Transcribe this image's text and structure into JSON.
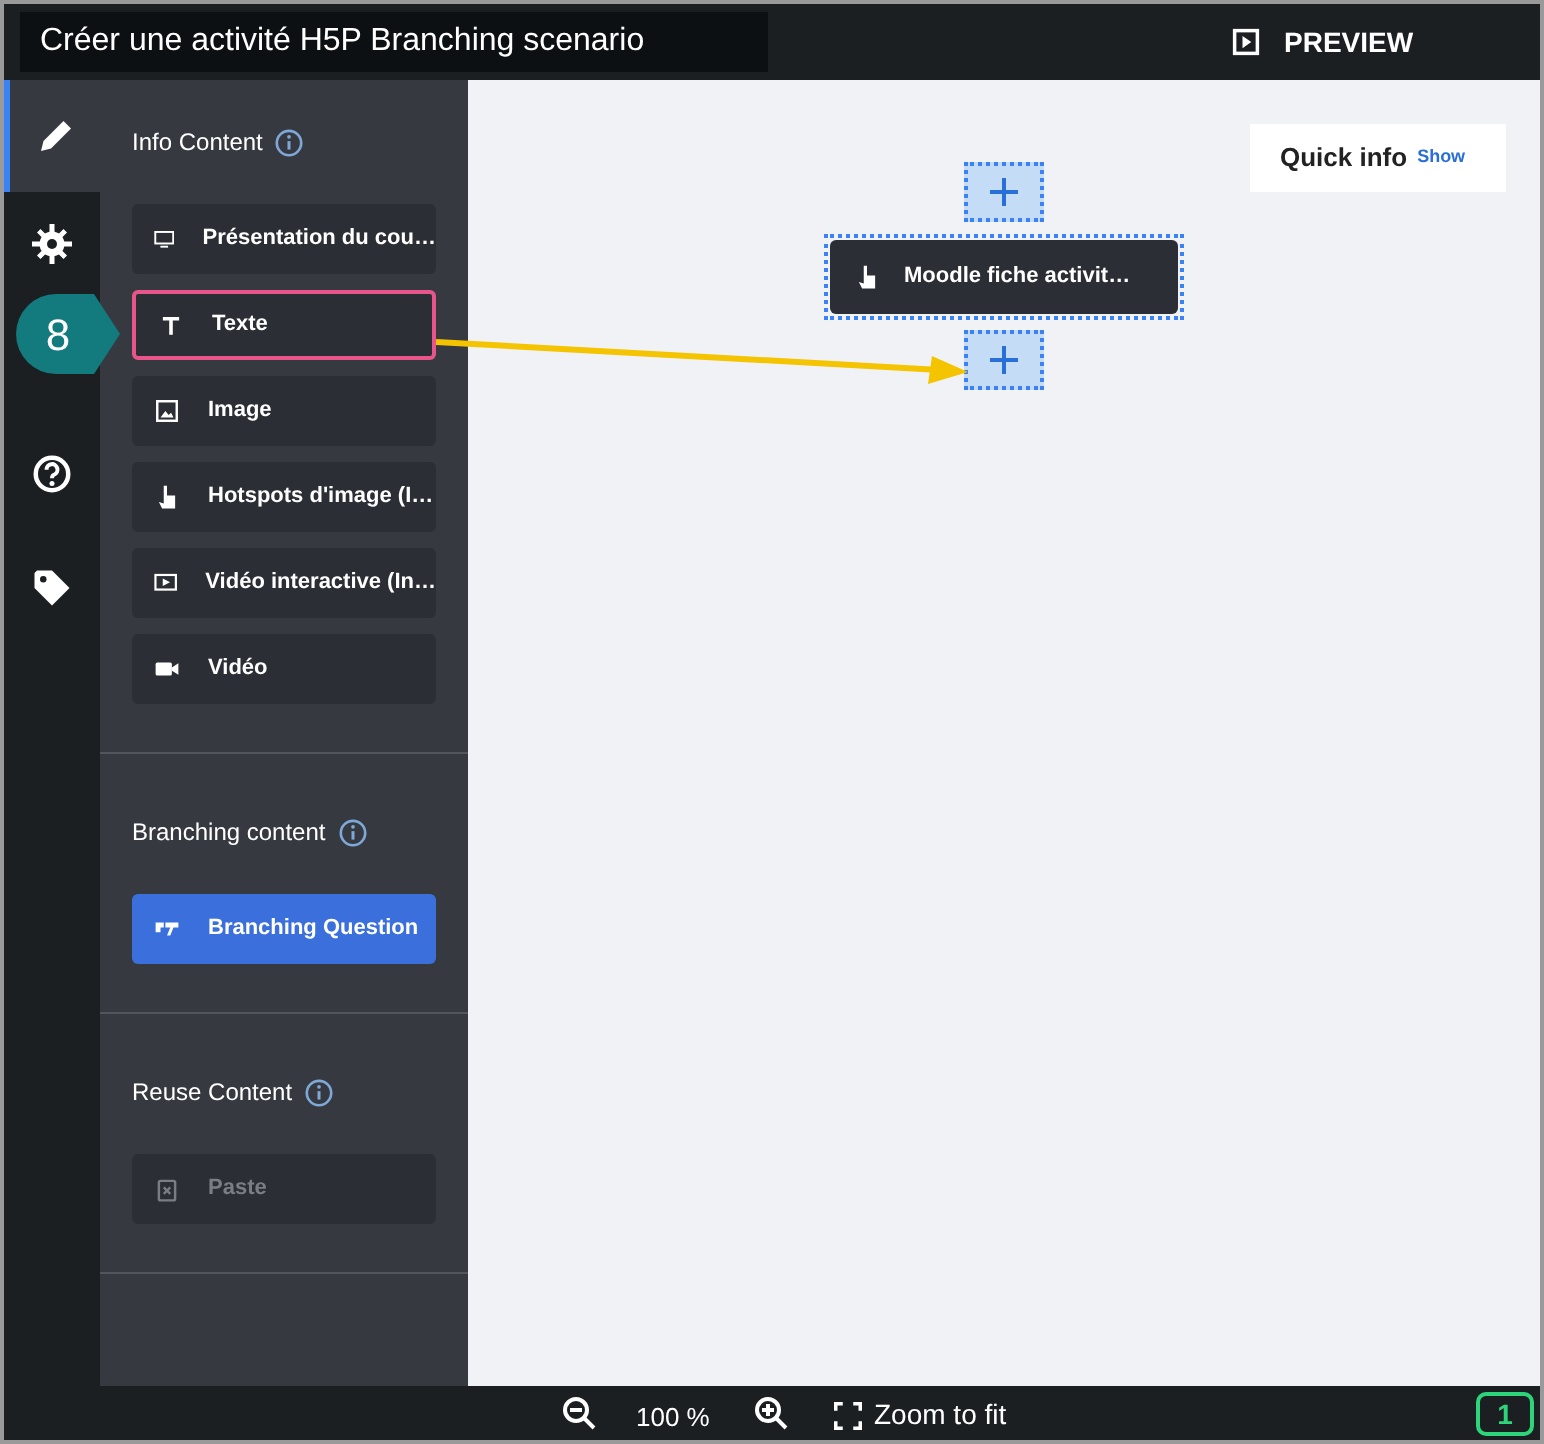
{
  "window": {
    "title": "Créer une activité H5P Branching scenario"
  },
  "preview_button": {
    "label": "PREVIEW"
  },
  "rail_tabs": [
    {
      "kind": "edit",
      "selected": true
    },
    {
      "kind": "settings",
      "selected": false
    },
    {
      "kind": "help",
      "selected": false
    },
    {
      "kind": "tags",
      "selected": false
    }
  ],
  "sections": [
    {
      "title": "Info Content",
      "items": [
        {
          "kind": "presentation",
          "label": "Présentation du cou…",
          "highlighted": false,
          "disabled": false,
          "primary": false
        },
        {
          "kind": "text",
          "label": "Texte",
          "highlighted": true,
          "disabled": false,
          "primary": false
        },
        {
          "kind": "image",
          "label": "Image",
          "highlighted": false,
          "disabled": false,
          "primary": false
        },
        {
          "kind": "hotspot",
          "label": "Hotspots d'image (I…",
          "highlighted": false,
          "disabled": false,
          "primary": false
        },
        {
          "kind": "interactive-video",
          "label": "Vidéo interactive (In…",
          "highlighted": false,
          "disabled": false,
          "primary": false
        },
        {
          "kind": "video",
          "label": "Vidéo",
          "highlighted": false,
          "disabled": false,
          "primary": false
        }
      ]
    },
    {
      "title": "Branching content",
      "items": [
        {
          "kind": "branching",
          "label": "Branching Question",
          "highlighted": false,
          "disabled": false,
          "primary": true
        }
      ]
    },
    {
      "title": "Reuse Content",
      "items": [
        {
          "kind": "paste",
          "label": "Paste",
          "highlighted": false,
          "disabled": true,
          "primary": false
        }
      ]
    }
  ],
  "canvas": {
    "node": {
      "label": "Moodle fiche activit…"
    },
    "quick_info": {
      "label": "Quick info",
      "link": "Show"
    }
  },
  "callout": {
    "label": "8"
  },
  "zoom_bar": {
    "zoom": "100 %",
    "fit": "Zoom to fit",
    "count": "1"
  }
}
